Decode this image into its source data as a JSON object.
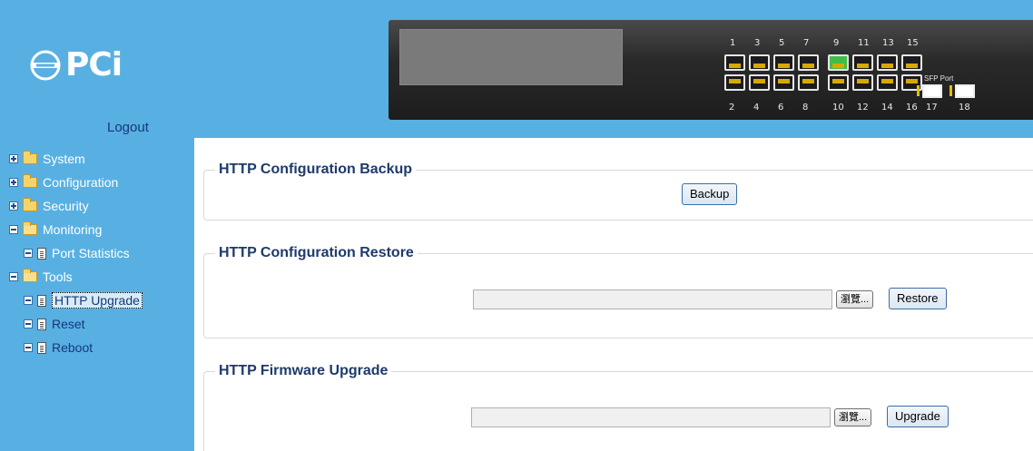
{
  "header": {
    "logo_text": "PCi",
    "logout_label": "Logout",
    "panel": {
      "top_ports": [
        "1",
        "3",
        "5",
        "7",
        "9",
        "11",
        "13",
        "15"
      ],
      "bottom_ports": [
        "2",
        "4",
        "6",
        "8",
        "10",
        "12",
        "14",
        "16"
      ],
      "sfp_ports": [
        "17",
        "18"
      ],
      "sfp_label": "SFP Port",
      "active_port": "9"
    }
  },
  "sidebar": {
    "items": [
      {
        "label": "System",
        "icon": "folder-icon",
        "toggle": "plus"
      },
      {
        "label": "Configuration",
        "icon": "folder-icon",
        "toggle": "plus"
      },
      {
        "label": "Security",
        "icon": "folder-icon",
        "toggle": "plus"
      },
      {
        "label": "Monitoring",
        "icon": "open-folder-icon",
        "toggle": "minus"
      },
      {
        "label": "Port Statistics",
        "icon": "document-icon",
        "toggle": "minus"
      },
      {
        "label": "Tools",
        "icon": "open-folder-icon",
        "toggle": "minus"
      },
      {
        "label": "HTTP Upgrade",
        "icon": "document-icon",
        "toggle": "minus",
        "selected": true
      },
      {
        "label": "Reset",
        "icon": "document-icon",
        "toggle": "minus"
      },
      {
        "label": "Reboot",
        "icon": "document-icon",
        "toggle": "minus"
      }
    ]
  },
  "main": {
    "backup": {
      "title": "HTTP Configuration Backup",
      "button": "Backup"
    },
    "restore": {
      "title": "HTTP Configuration Restore",
      "browse": "瀏覽...",
      "button": "Restore",
      "file_value": ""
    },
    "upgrade": {
      "title": "HTTP Firmware Upgrade",
      "browse": "瀏覽...",
      "button": "Upgrade",
      "file_value": ""
    }
  },
  "colors": {
    "sidebar_bg": "#58b0e2",
    "header_bg": "#58b0e2",
    "section_title": "#1e3a6b",
    "button_border": "#3a6ea5",
    "selected_item": "#000000"
  }
}
